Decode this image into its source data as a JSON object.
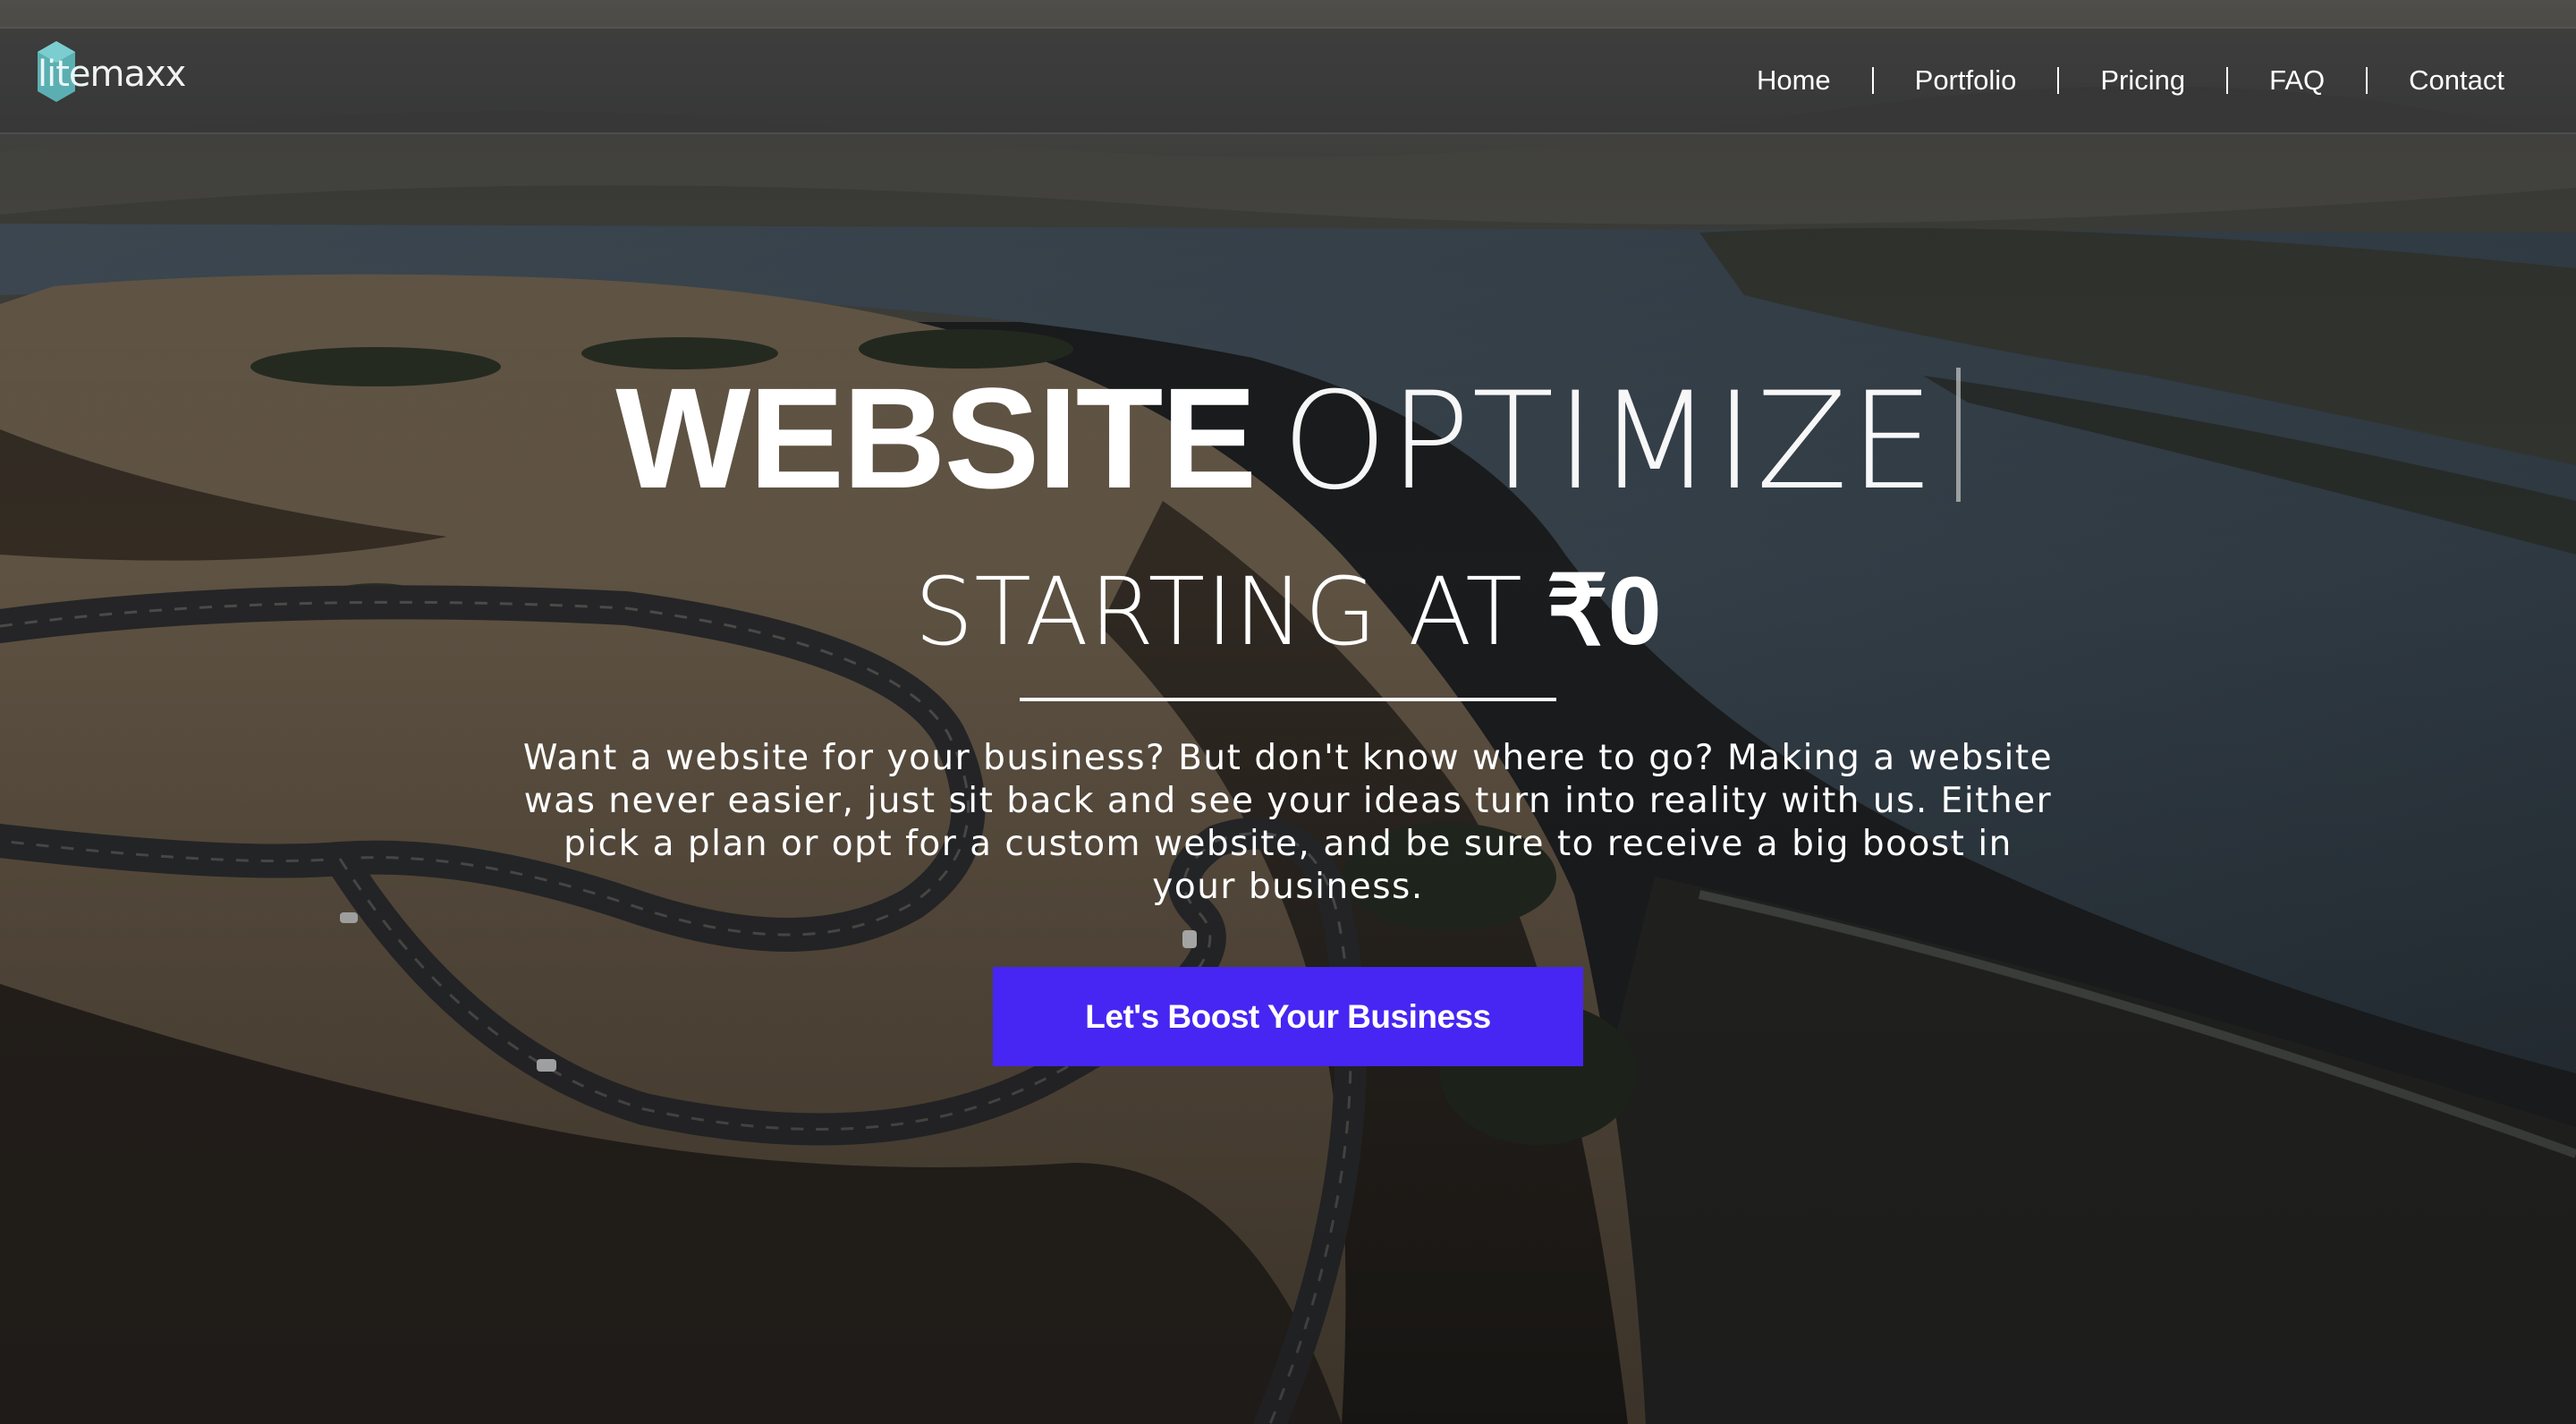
{
  "brand": {
    "name": "litemaxx",
    "name_part1": "lite",
    "name_part2": "maxx",
    "accent": "#5fbcc0",
    "icon": "hexagon-logo-icon"
  },
  "nav": {
    "items": [
      {
        "label": "Home"
      },
      {
        "label": "Portfolio"
      },
      {
        "label": "Pricing"
      },
      {
        "label": "FAQ"
      },
      {
        "label": "Contact"
      }
    ]
  },
  "hero": {
    "headline_bold": "WEBSITE",
    "headline_light": "OPTIMIZE",
    "subhead_text": "STARTING AT",
    "subhead_price": "₹0",
    "description": "Want a website for your business? But don't know where to go? Making a website was never easier, just sit back and see your ideas turn into reality with us. Either pick a plan or opt for a custom website, and be sure to receive a big boost in your business.",
    "cta_label": "Let's Boost Your Business",
    "cta_color": "#4726f3"
  }
}
